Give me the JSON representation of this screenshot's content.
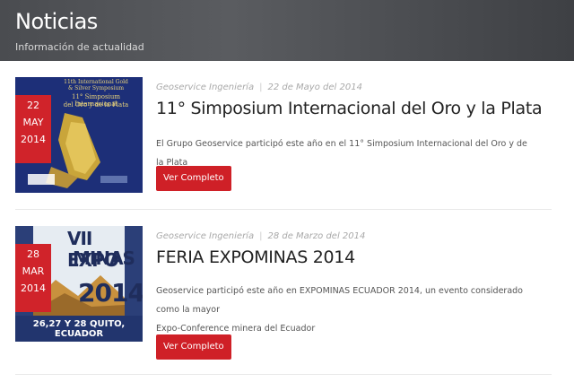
{
  "banner": {
    "title": "Noticias",
    "subtitle": "Información de actualidad"
  },
  "news": [
    {
      "author": "Geoservice Ingeniería",
      "date": "22 de Mayo del 2014",
      "badge": {
        "day": "22",
        "month": "MAY",
        "year": "2014"
      },
      "title": "11° Simposium Internacional del Oro y la Plata",
      "excerpt": "El Grupo Geoservice participó este año en el 11° Simposium Internacional del Oro y de la Plata",
      "button": "Ver Completo",
      "thumb_text": {
        "line1": "11th International Gold",
        "line2": "& Silver Symposium",
        "line3": "11° Simposium Internacional",
        "line4": "del Oro y de la Plata"
      }
    },
    {
      "author": "Geoservice Ingeniería",
      "date": "28 de Marzo del 2014",
      "badge": {
        "day": "28",
        "month": "MAR",
        "year": "2014"
      },
      "title": "FERIA EXPOMINAS 2014",
      "excerpt_line1": "Geoservice participó este año en EXPOMINAS ECUADOR 2014, un evento considerado como la mayor",
      "excerpt_line2": "Expo-Conference minera del Ecuador",
      "button": "Ver Completo",
      "thumb_text": {
        "line1": "VII EXPO",
        "line2": "MINAS",
        "line3": "2014",
        "line4": "26,27 Y 28 QUITO, ECUADOR"
      }
    }
  ],
  "colors": {
    "accent": "#d0232a",
    "banner_bg": "#4a4c50"
  }
}
